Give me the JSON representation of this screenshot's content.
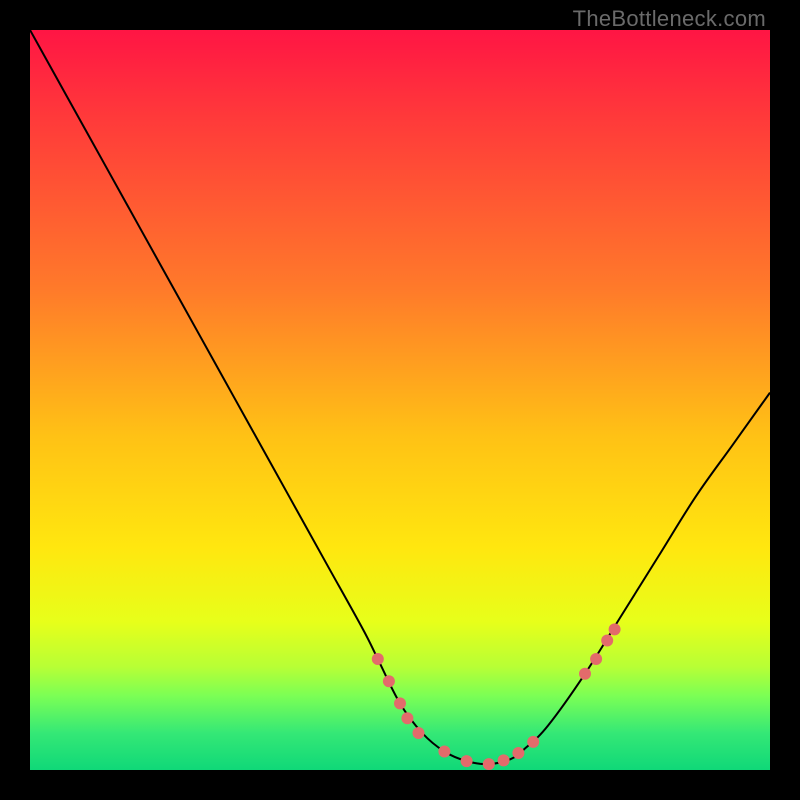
{
  "watermark": "TheBottleneck.com",
  "chart_data": {
    "type": "line",
    "title": "",
    "xlabel": "",
    "ylabel": "",
    "xlim": [
      0,
      100
    ],
    "ylim": [
      0,
      100
    ],
    "grid": false,
    "legend": false,
    "series": [
      {
        "name": "bottleneck-curve",
        "x": [
          0,
          5,
          10,
          15,
          20,
          25,
          30,
          35,
          40,
          45,
          47,
          50,
          53,
          56,
          59,
          62,
          65,
          67,
          70,
          75,
          80,
          85,
          90,
          95,
          100
        ],
        "y": [
          100,
          91,
          82,
          73,
          64,
          55,
          46,
          37,
          28,
          19,
          15,
          9,
          5,
          2.5,
          1.2,
          0.8,
          1.5,
          3,
          6,
          13,
          21,
          29,
          37,
          44,
          51
        ]
      }
    ],
    "markers": {
      "name": "highlight-points",
      "color": "#e36b6b",
      "radius_px": 6,
      "points": [
        {
          "x": 47,
          "y": 15
        },
        {
          "x": 48.5,
          "y": 12
        },
        {
          "x": 50,
          "y": 9
        },
        {
          "x": 51,
          "y": 7
        },
        {
          "x": 52.5,
          "y": 5
        },
        {
          "x": 56,
          "y": 2.5
        },
        {
          "x": 59,
          "y": 1.2
        },
        {
          "x": 62,
          "y": 0.8
        },
        {
          "x": 64,
          "y": 1.3
        },
        {
          "x": 66,
          "y": 2.3
        },
        {
          "x": 68,
          "y": 3.8
        },
        {
          "x": 75,
          "y": 13
        },
        {
          "x": 76.5,
          "y": 15
        },
        {
          "x": 78,
          "y": 17.5
        },
        {
          "x": 79,
          "y": 19
        }
      ]
    },
    "background_gradient": {
      "stops": [
        {
          "pos": 0.0,
          "color": "#ff1544"
        },
        {
          "pos": 0.35,
          "color": "#ff7a2a"
        },
        {
          "pos": 0.7,
          "color": "#ffe70f"
        },
        {
          "pos": 0.9,
          "color": "#7bff55"
        },
        {
          "pos": 1.0,
          "color": "#10d878"
        }
      ]
    }
  }
}
